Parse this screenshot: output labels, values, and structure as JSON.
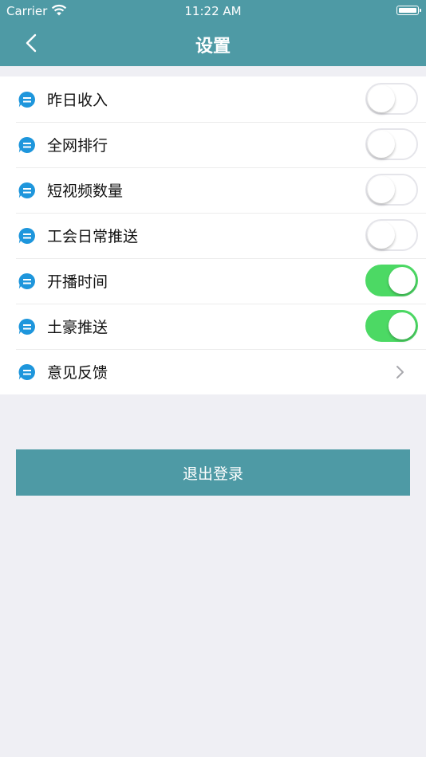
{
  "status_bar": {
    "carrier": "Carrier",
    "time": "11:22 AM"
  },
  "nav": {
    "title": "设置"
  },
  "settings": {
    "items": [
      {
        "label": "昨日收入",
        "toggle_on": false
      },
      {
        "label": "全网排行",
        "toggle_on": false
      },
      {
        "label": "短视频数量",
        "toggle_on": false
      },
      {
        "label": "工会日常推送",
        "toggle_on": false
      },
      {
        "label": "开播时间",
        "toggle_on": true
      },
      {
        "label": "土豪推送",
        "toggle_on": true
      },
      {
        "label": "意见反馈"
      }
    ]
  },
  "logout_label": "退出登录",
  "colors": {
    "brand": "#4e9aa5",
    "toggle_on": "#4cd964",
    "icon": "#1e96dc",
    "background": "#efeff4"
  },
  "icons": {
    "row_icon": "message-bubble-icon",
    "back": "chevron-left-icon",
    "disclosure": "chevron-right-icon"
  }
}
